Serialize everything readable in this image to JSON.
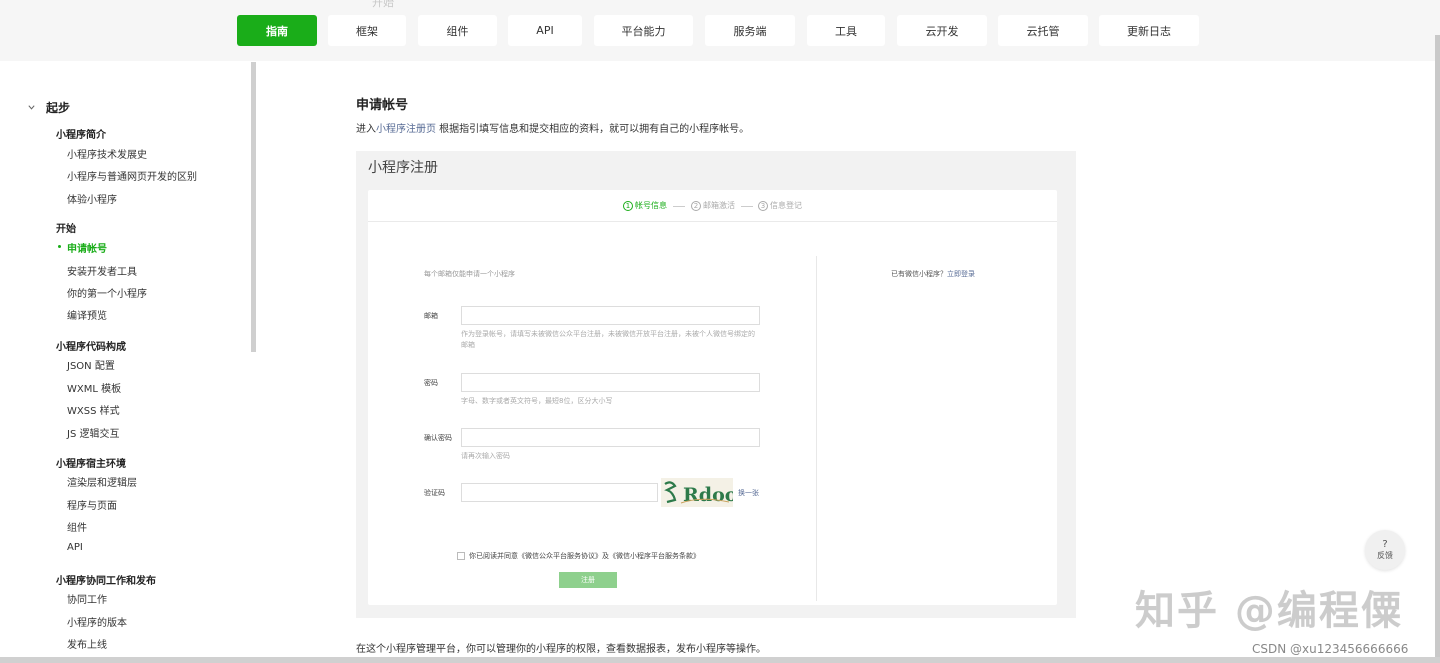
{
  "nav": {
    "ghost_text": "开始",
    "items": [
      {
        "label": "指南",
        "active": true
      },
      {
        "label": "框架"
      },
      {
        "label": "组件"
      },
      {
        "label": "API"
      },
      {
        "label": "平台能力"
      },
      {
        "label": "服务端"
      },
      {
        "label": "工具"
      },
      {
        "label": "云开发"
      },
      {
        "label": "云托管"
      },
      {
        "label": "更新日志"
      }
    ]
  },
  "sidebar": {
    "section_title": "起步",
    "groups": [
      {
        "title": "小程序简介",
        "items": [
          "小程序技术发展史",
          "小程序与普通网页开发的区别",
          "体验小程序"
        ]
      },
      {
        "title": "开始",
        "items": [
          "申请帐号",
          "安装开发者工具",
          "你的第一个小程序",
          "编译预览"
        ]
      },
      {
        "title": "小程序代码构成",
        "items": [
          "JSON 配置",
          "WXML 模板",
          "WXSS 样式",
          "JS 逻辑交互"
        ]
      },
      {
        "title": "小程序宿主环境",
        "items": [
          "渲染层和逻辑层",
          "程序与页面",
          "组件",
          "API"
        ]
      },
      {
        "title": "小程序协同工作和发布",
        "items": [
          "协同工作",
          "小程序的版本",
          "发布上线"
        ]
      }
    ],
    "active_item": "申请帐号"
  },
  "content": {
    "title": "申请帐号",
    "intro_prefix": "进入",
    "intro_link": "小程序注册页",
    "intro_suffix": " 根据指引填写信息和提交相应的资料，就可以拥有自己的小程序帐号。",
    "bottom_text": "在这个小程序管理平台，你可以管理你的小程序的权限，查看数据报表，发布小程序等操作。"
  },
  "screenshot": {
    "title": "小程序注册",
    "steps": [
      {
        "num": "1",
        "label": "帐号信息",
        "active": true
      },
      {
        "num": "2",
        "label": "邮箱激活"
      },
      {
        "num": "3",
        "label": "信息登记"
      }
    ],
    "tip": "每个邮箱仅能申请一个小程序",
    "login_prompt": "已有微信小程序？",
    "login_link": "立即登录",
    "fields": {
      "email_label": "邮箱",
      "email_hint": "作为登录帐号，请填写未被微信公众平台注册，未被微信开放平台注册，未被个人微信号绑定的邮箱",
      "password_label": "密码",
      "password_hint": "字母、数字或者英文符号，最短8位，区分大小写",
      "confirm_label": "确认密码",
      "confirm_hint": "请再次输入密码",
      "captcha_label": "验证码",
      "captcha_text": "Rdoo",
      "swap_label": "换一张"
    },
    "agree_text": "你已阅读并同意《微信公众平台服务协议》及《微信小程序平台服务条款》",
    "register_button": "注册"
  },
  "feedback": {
    "icon": "?",
    "label": "反馈"
  },
  "watermark": "知乎 @编程僳",
  "csdn_credit": "CSDN @xu123456666666",
  "colors": {
    "accent": "#1aad19",
    "link": "#576b95"
  }
}
